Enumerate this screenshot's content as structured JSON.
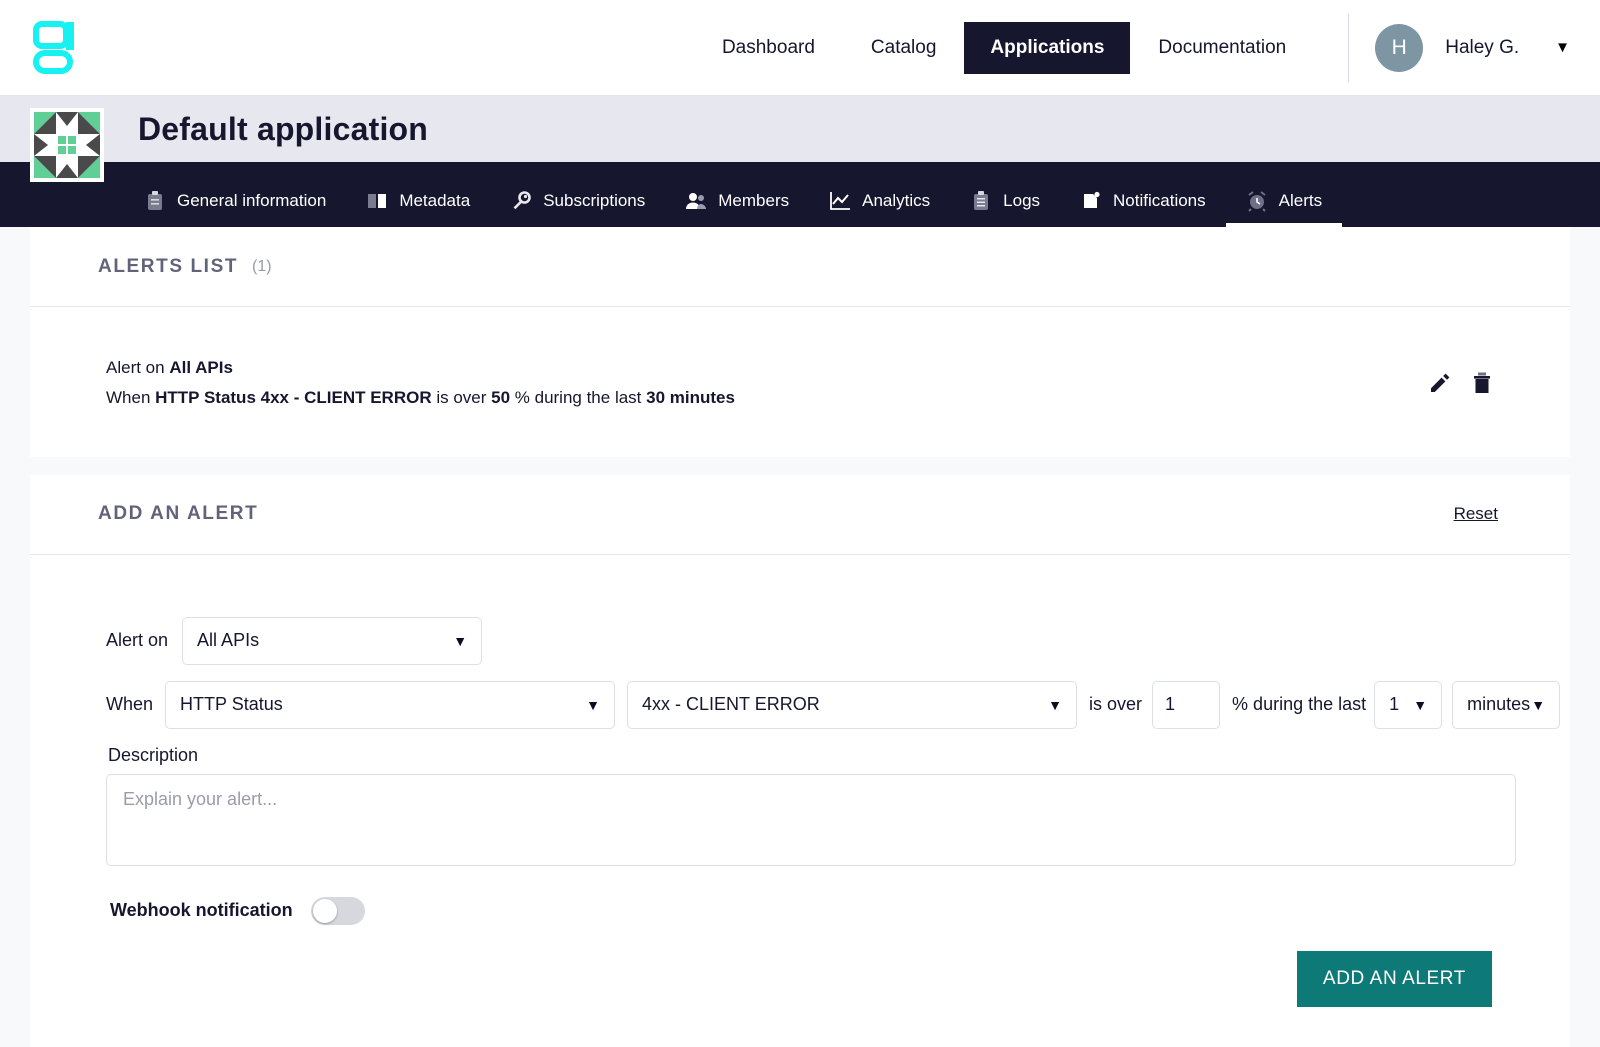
{
  "brand": {
    "logo_icon": "gravitee-g-logo",
    "logo_color": "#17f1f1"
  },
  "topnav": {
    "links": [
      {
        "label": "Dashboard",
        "active": false
      },
      {
        "label": "Catalog",
        "active": false
      },
      {
        "label": "Applications",
        "active": true
      },
      {
        "label": "Documentation",
        "active": false
      }
    ],
    "user": {
      "initial": "H",
      "name": "Haley G.",
      "caret": "▼"
    }
  },
  "app_header": {
    "title": "Default application",
    "icon": "application-identicon"
  },
  "tabs": [
    {
      "label": "General information",
      "icon": "clipboard-icon",
      "active": false
    },
    {
      "label": "Metadata",
      "icon": "book-icon",
      "active": false
    },
    {
      "label": "Subscriptions",
      "icon": "key-icon",
      "active": false
    },
    {
      "label": "Members",
      "icon": "people-icon",
      "active": false
    },
    {
      "label": "Analytics",
      "icon": "chart-line-icon",
      "active": false
    },
    {
      "label": "Logs",
      "icon": "clipboard-list-icon",
      "active": false
    },
    {
      "label": "Notifications",
      "icon": "page-icon",
      "active": false
    },
    {
      "label": "Alerts",
      "icon": "alarm-clock-icon",
      "active": true
    }
  ],
  "alerts_list": {
    "title": "ALERTS LIST",
    "count": "(1)",
    "items": [
      {
        "line1_prefix": "Alert on ",
        "line1_target": "All APIs",
        "line2_prefix": "When ",
        "line2_metric": "HTTP Status 4xx - CLIENT ERROR",
        "line2_mid": " is over ",
        "line2_threshold": "50",
        "line2_unit": " % during the last ",
        "line2_duration": "30 minutes",
        "edit_icon": "pencil-icon",
        "delete_icon": "trash-icon"
      }
    ]
  },
  "add_alert": {
    "title": "ADD AN ALERT",
    "reset_label": "Reset",
    "alert_on_label": "Alert on",
    "alert_on_value": "All APIs",
    "when_label": "When",
    "metric_value": "HTTP Status",
    "status_value": "4xx - CLIENT ERROR",
    "is_over_label": "is over",
    "threshold_value": "1",
    "percent_label": "% during the last",
    "duration_value": "1",
    "duration_unit": "minutes",
    "description_label": "Description",
    "description_value": "",
    "description_placeholder": "Explain your alert...",
    "webhook_label": "Webhook notification",
    "webhook_enabled": false,
    "submit_label": "ADD AN ALERT",
    "submit_color": "#0d7a77"
  }
}
